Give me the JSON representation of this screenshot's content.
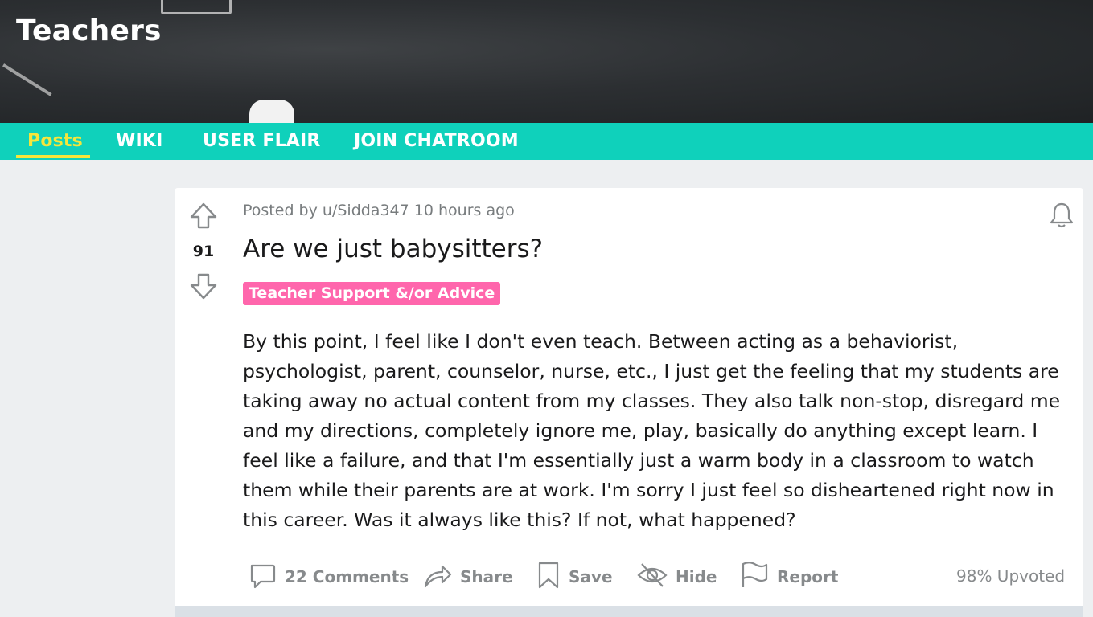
{
  "subreddit": {
    "name": "Teachers"
  },
  "nav": {
    "tabs": [
      {
        "label": "Posts",
        "active": true
      },
      {
        "label": "WIKI"
      },
      {
        "label": "USER FLAIR"
      },
      {
        "label": "JOIN CHATROOM"
      }
    ]
  },
  "post": {
    "posted_by_prefix": "Posted by",
    "author": "u/Sidda347",
    "time": "10 hours ago",
    "votes": "91",
    "title": "Are we just babysitters?",
    "flair": "Teacher Support &/or Advice",
    "body": "By this point, I feel like I don't even teach. Between acting as a behaviorist, psychologist, parent, counselor, nurse, etc., I just get the feeling that my students are taking away no actual content from my classes. They also talk non-stop, disregard me and my directions, completely ignore me, play, basically do anything except learn. I feel like a failure, and that I'm essentially just a warm body in a classroom to watch them while their parents are at work. I'm sorry I just feel so disheartened right now in this career. Was it always like this? If not, what happened?",
    "actions": {
      "comments": "22 Comments",
      "share": "Share",
      "save": "Save",
      "hide": "Hide",
      "report": "Report"
    },
    "upvoted": "98% Upvoted"
  },
  "icons": [
    "upvote-arrow-icon",
    "downvote-arrow-icon",
    "bell-icon",
    "comment-icon",
    "share-arrow-icon",
    "bookmark-icon",
    "eye-slash-icon",
    "flag-icon"
  ],
  "colors": {
    "nav_bg": "#0fd1bb",
    "nav_active": "#f5e63b",
    "flair_bg": "#ff66ac",
    "muted_text": "#878a8c",
    "page_bg": "#edeff1"
  }
}
